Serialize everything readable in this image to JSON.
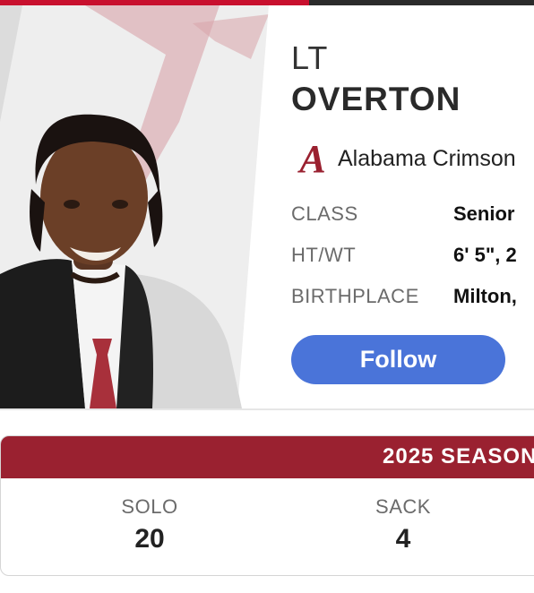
{
  "colors": {
    "accent": "#c8102e",
    "team_header": "#9a2130",
    "follow_button": "#4a74d9"
  },
  "player": {
    "position": "LT",
    "name": "OVERTON",
    "team": "Alabama Crimson",
    "team_logo_letter": "A",
    "info": [
      {
        "label": "CLASS",
        "value": "Senior"
      },
      {
        "label": "HT/WT",
        "value": "6' 5\", 2"
      },
      {
        "label": "BIRTHPLACE",
        "value": "Milton,"
      }
    ]
  },
  "follow_label": "Follow",
  "stats": {
    "header": "2025 SEASON",
    "items": [
      {
        "label": "SOLO",
        "value": "20"
      },
      {
        "label": "SACK",
        "value": "4"
      }
    ]
  }
}
